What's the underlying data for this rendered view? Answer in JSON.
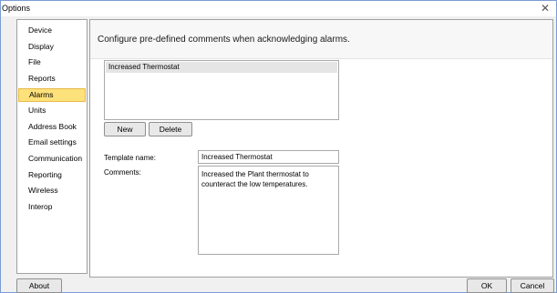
{
  "window": {
    "title": "Options",
    "close_icon": "close-icon"
  },
  "sidebar": {
    "items": [
      {
        "label": "Device"
      },
      {
        "label": "Display"
      },
      {
        "label": "File"
      },
      {
        "label": "Reports"
      },
      {
        "label": "Alarms",
        "selected": true
      },
      {
        "label": "Units"
      },
      {
        "label": "Address Book"
      },
      {
        "label": "Email settings"
      },
      {
        "label": "Communication"
      },
      {
        "label": "Reporting"
      },
      {
        "label": "Wireless"
      },
      {
        "label": "Interop"
      }
    ]
  },
  "content": {
    "header": "Configure pre-defined comments when acknowledging alarms.",
    "list": {
      "items": [
        "Increased Thermostat"
      ],
      "selected": "Increased Thermostat"
    },
    "buttons": {
      "new": "New",
      "delete": "Delete"
    },
    "form": {
      "template_label": "Template name:",
      "template_value": "Increased Thermostat",
      "comments_label": "Comments:",
      "comments_line1": "Increased the Plant thermostat to",
      "comments_line2": "counteract the low temperatures."
    }
  },
  "footer": {
    "about": "About",
    "ok": "OK",
    "cancel": "Cancel"
  },
  "colors": {
    "selected_bg": "#fde17a",
    "window_border": "#7a9cd3",
    "list_selected_bg": "#e5e5e5"
  }
}
